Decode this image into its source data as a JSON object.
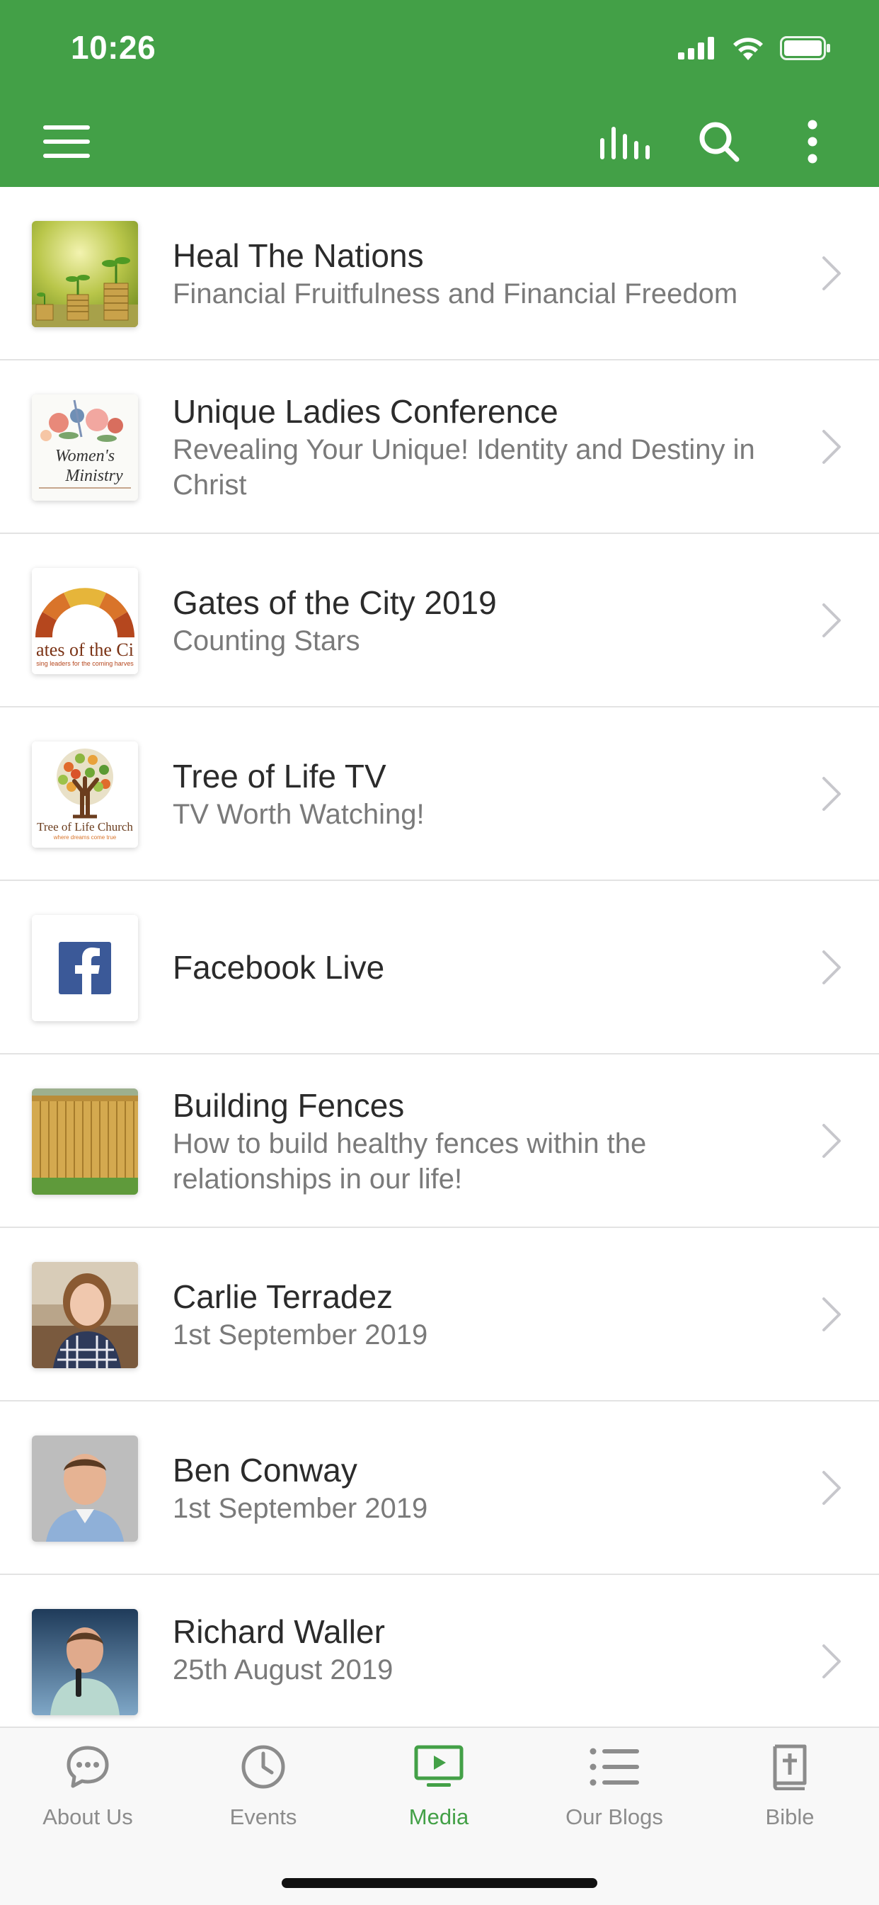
{
  "status": {
    "time": "10:26"
  },
  "appbar": {
    "menu_icon": "hamburger-menu-icon",
    "audio_icon": "audio-bars-icon",
    "search_icon": "search-icon",
    "more_icon": "more-vertical-icon"
  },
  "items": [
    {
      "title": "Heal The Nations",
      "subtitle": "Financial Fruitfulness and Financial Freedom",
      "thumb": "plant-coins-image"
    },
    {
      "title": "Unique Ladies Conference",
      "subtitle": "Revealing Your Unique! Identity and Destiny in Christ",
      "thumb": "womens-ministry-image",
      "thumb_text_1": "Women's",
      "thumb_text_2": "Ministry"
    },
    {
      "title": "Gates of the City 2019",
      "subtitle": "Counting Stars",
      "thumb": "gates-of-the-city-logo",
      "thumb_text_1": "ates of the Ci",
      "thumb_text_2": "sing leaders for the coming harves"
    },
    {
      "title": "Tree of Life TV",
      "subtitle": "TV Worth Watching!",
      "thumb": "tree-of-life-logo",
      "thumb_text_1": "Tree of Life Church",
      "thumb_text_2": "where dreams come true"
    },
    {
      "title": "Facebook Live",
      "subtitle": "",
      "thumb": "facebook-logo"
    },
    {
      "title": "Building Fences",
      "subtitle": "How to build healthy fences within the relationships in our life!",
      "thumb": "wooden-fence-image"
    },
    {
      "title": "Carlie Terradez",
      "subtitle": "1st September 2019",
      "thumb": "carlie-portrait"
    },
    {
      "title": "Ben Conway",
      "subtitle": "1st September 2019",
      "thumb": "ben-portrait"
    },
    {
      "title": "Richard Waller",
      "subtitle": "25th August 2019",
      "thumb": "richard-portrait"
    }
  ],
  "tabs": [
    {
      "label": "About Us",
      "icon": "chat-bubble-icon"
    },
    {
      "label": "Events",
      "icon": "clock-icon"
    },
    {
      "label": "Media",
      "icon": "tv-play-icon",
      "active": true
    },
    {
      "label": "Our Blogs",
      "icon": "list-icon"
    },
    {
      "label": "Bible",
      "icon": "bible-cross-icon"
    }
  ],
  "colors": {
    "primary": "#43a047",
    "inactive": "#8c8c8c",
    "text": "#2b2b2b",
    "subtext": "#7a7a7a"
  }
}
